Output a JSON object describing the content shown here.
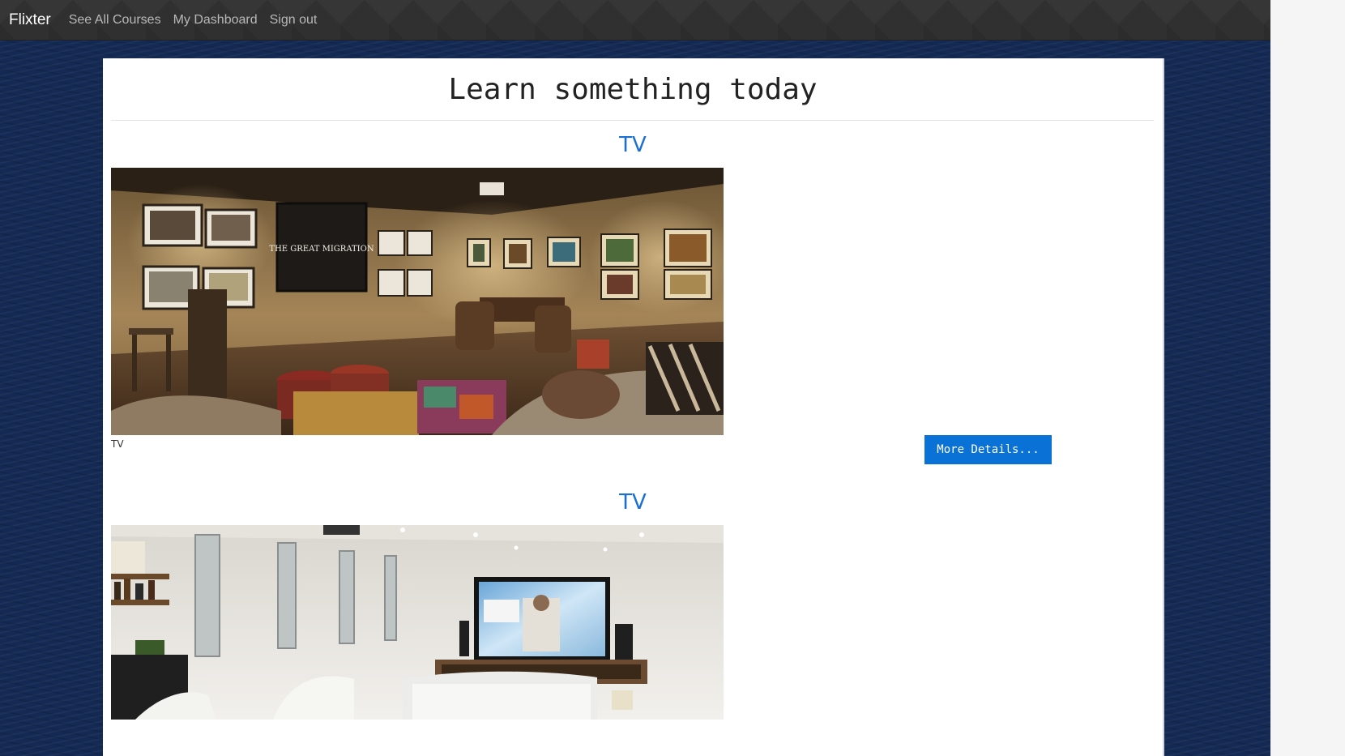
{
  "navbar": {
    "brand": "Flixter",
    "links": [
      "See All Courses",
      "My Dashboard",
      "Sign out"
    ]
  },
  "page": {
    "title": "Learn something today"
  },
  "courses": [
    {
      "title": "TV",
      "caption": "TV",
      "button_label": "More Details...",
      "image_icon": "home-theater-photo-warm",
      "screen_text": "THE GREAT MIGRATION"
    },
    {
      "title": "TV",
      "image_icon": "home-theater-photo-white"
    }
  ],
  "colors": {
    "navbar": "#303030",
    "background": "#142a54",
    "link_blue": "#1a6fd1",
    "button_blue": "#0a72d6"
  }
}
